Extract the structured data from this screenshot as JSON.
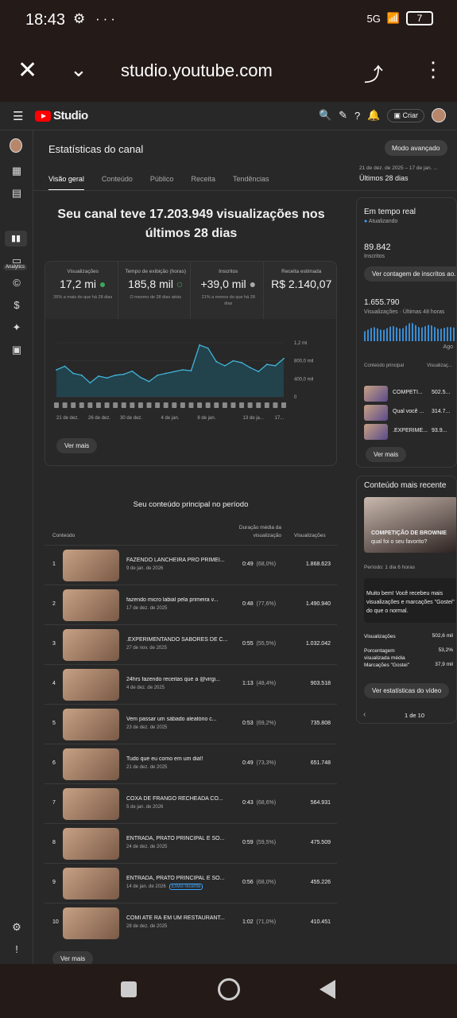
{
  "status": {
    "time": "18:43",
    "network": "5G",
    "battery": "7"
  },
  "browser": {
    "url": "studio.youtube.com"
  },
  "topnav": {
    "logo_text": "Studio",
    "create_label": "Criar"
  },
  "sidebar": {
    "analytics_label": "Analytics"
  },
  "page": {
    "title": "Estatísticas do canal",
    "advanced_button": "Modo avançado",
    "tabs": [
      "Visão geral",
      "Conteúdo",
      "Público",
      "Receita",
      "Tendências"
    ],
    "date_range": "21 de dez. de 2025 – 17 de jan. ...",
    "date_label": "Últimos 28 dias",
    "headline": "Seu canal teve 17.203.949 visualizações nos últimos 28 dias"
  },
  "metrics": [
    {
      "label": "Visualizações",
      "value": "17,2 mi",
      "sub": "26% a mais do que há 28 dias"
    },
    {
      "label": "Tempo de exibição (horas)",
      "value": "185,8 mil",
      "sub": "O mesmo de 28 dias atrás"
    },
    {
      "label": "Inscritos",
      "value": "+39,0 mil",
      "sub": "21% a menos do que há 28 dias"
    },
    {
      "label": "Receita estimada",
      "value": "R$ 2.140,07",
      "sub": ""
    }
  ],
  "chart_data": {
    "type": "area",
    "x": [
      "21 de dez.",
      "26 de dez.",
      "30 de dez.",
      "4 de jan.",
      "8 de jan.",
      "13 de ja...",
      "17..."
    ],
    "y_ticks": [
      "1,2 mi",
      "800,0 mil",
      "400,0 mil",
      "0"
    ],
    "ylim": [
      0,
      1200000
    ],
    "values": [
      600000,
      680000,
      520000,
      480000,
      310000,
      460000,
      420000,
      480000,
      500000,
      570000,
      430000,
      340000,
      480000,
      520000,
      560000,
      600000,
      580000,
      1150000,
      1080000,
      780000,
      690000,
      800000,
      760000,
      650000,
      560000,
      720000,
      690000,
      850000
    ]
  },
  "chart_more": "Ver mais",
  "top_content": {
    "title": "Seu conteúdo principal no período",
    "col_content": "Conteúdo",
    "col_duration": "Duração média da visualização",
    "col_views": "Visualizações",
    "rows": [
      {
        "n": "1",
        "title": "FAZENDO LANCHEIRA PRO PRIMEI...",
        "date": "9 de jan. de 2026",
        "dur": "0:49",
        "pct": "(68,0%)",
        "views": "1.868.623"
      },
      {
        "n": "2",
        "title": "fazendo micro labial pela primeira v...",
        "date": "17 de dez. de 2025",
        "dur": "0:48",
        "pct": "(77,6%)",
        "views": "1.490.940"
      },
      {
        "n": "3",
        "title": ".EXPERIMENTANDO SABORES DE C...",
        "date": "27 de nov. de 2025",
        "dur": "0:55",
        "pct": "(55,5%)",
        "views": "1.032.042"
      },
      {
        "n": "4",
        "title": "24hrs fazendo receitas que a @virgi...",
        "date": "4 de dez. de 2025",
        "dur": "1:13",
        "pct": "(48,4%)",
        "views": "903.518"
      },
      {
        "n": "5",
        "title": "Vem passar um sábado aleatório c...",
        "date": "23 de dez. de 2025",
        "dur": "0:53",
        "pct": "(69,2%)",
        "views": "735.808"
      },
      {
        "n": "6",
        "title": "Tudo que eu como em um dia!!",
        "date": "21 de dez. de 2025",
        "dur": "0:49",
        "pct": "(73,3%)",
        "views": "651.748"
      },
      {
        "n": "7",
        "title": "COXA DE FRANGO RECHEADA CO...",
        "date": "5 de jan. de 2026",
        "dur": "0:43",
        "pct": "(68,6%)",
        "views": "564.931"
      },
      {
        "n": "8",
        "title": "ENTRADA, PRATO PRINCIPAL E SO...",
        "date": "24 de dez. de 2025",
        "dur": "0:59",
        "pct": "(59,5%)",
        "views": "475.509"
      },
      {
        "n": "9",
        "title": "ENTRADA, PRATO PRINCIPAL E SO...",
        "date": "14 de jan. de 2026",
        "badge": "Envio recente",
        "dur": "0:56",
        "pct": "(68,0%)",
        "views": "455.226"
      },
      {
        "n": "10",
        "title": "COMI ATÉ RÃ EM UM RESTAURANT...",
        "date": "28 de dez. de 2025",
        "dur": "1:02",
        "pct": "(71,0%)",
        "views": "410.451"
      }
    ],
    "more": "Ver mais"
  },
  "realtime": {
    "title": "Em tempo real",
    "updating": "Atualizando",
    "subs_value": "89.842",
    "subs_label": "Inscritos",
    "subs_button": "Ver contagem de inscritos ao...",
    "views_value": "1.655.790",
    "views_label": "Visualizações · Últimas 48 horas",
    "ago": "Ago",
    "col_content": "Conteúdo principal",
    "col_views": "Visualizaç...",
    "items": [
      {
        "title": "COMPETI...",
        "views": "502.5..."
      },
      {
        "title": "Qual você ...",
        "views": "314.7..."
      },
      {
        "title": ".EXPERIME...",
        "views": "93.9..."
      }
    ],
    "more": "Ver mais"
  },
  "latest": {
    "title": "Conteúdo mais recente",
    "video_title": "COMPETIÇÃO DE BROWNIE",
    "video_sub": "qual foi o seu favorito?",
    "period": "Período: 1 dia 6 horas",
    "message": "Muito bem! Você recebeu mais visualizações e marcações \"Gostei\" do que o normal.",
    "stats": [
      {
        "label": "Visualizações",
        "value": "502,6 mil"
      },
      {
        "label": "Porcentagem visualizada média",
        "value": "53,2%"
      },
      {
        "label": "Marcações \"Gostei\"",
        "value": "37,9 mil"
      }
    ],
    "stats_button": "Ver estatísticas do vídeo",
    "pager": "1 de 10"
  }
}
